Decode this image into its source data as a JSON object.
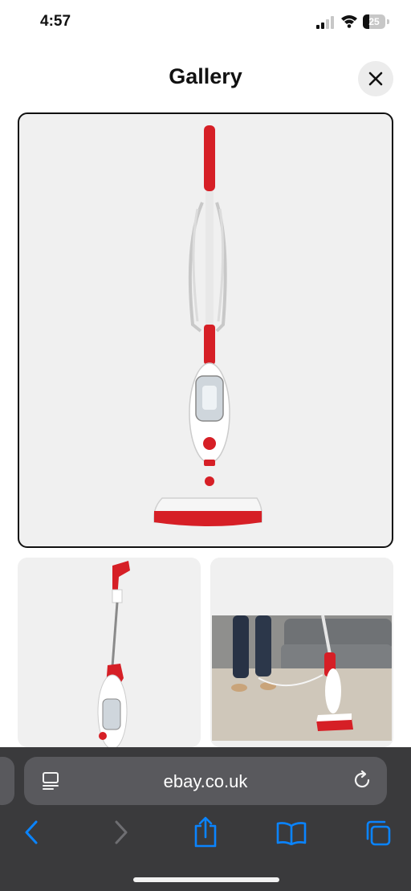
{
  "status_bar": {
    "time": "4:57",
    "battery_level": "25"
  },
  "header": {
    "title": "Gallery"
  },
  "gallery": {
    "images": [
      {
        "name": "main-product-image",
        "selected": true
      },
      {
        "name": "thumbnail-side-view",
        "selected": false
      },
      {
        "name": "thumbnail-in-room",
        "selected": false
      }
    ]
  },
  "browser": {
    "url": "ebay.co.uk",
    "icons": [
      "reader-icon",
      "reload-icon",
      "back-icon",
      "forward-icon",
      "share-icon",
      "bookmarks-icon",
      "tabs-icon"
    ]
  },
  "colors": {
    "accent_red": "#d61f26",
    "toolbar_bg": "#3a3a3c",
    "link_blue": "#0a84ff"
  }
}
